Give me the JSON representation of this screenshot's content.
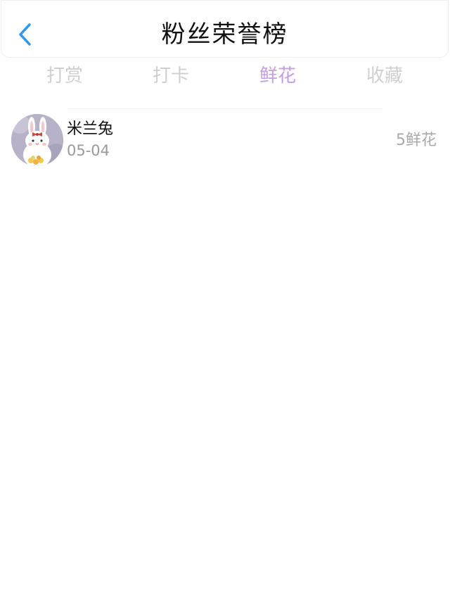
{
  "header": {
    "title": "粉丝荣誉榜",
    "back_icon": "chevron-left-icon",
    "accent_color": "#2f9be8"
  },
  "tabs": [
    {
      "label": "打赏",
      "active": false
    },
    {
      "label": "打卡",
      "active": false
    },
    {
      "label": "鲜花",
      "active": true
    },
    {
      "label": "收藏",
      "active": false
    }
  ],
  "active_tab_color": "#c39ee6",
  "list": [
    {
      "name": "米兰兔",
      "date": "05-04",
      "count_text": "5鲜花",
      "avatar_icon": "bunny-avatar-icon"
    }
  ]
}
